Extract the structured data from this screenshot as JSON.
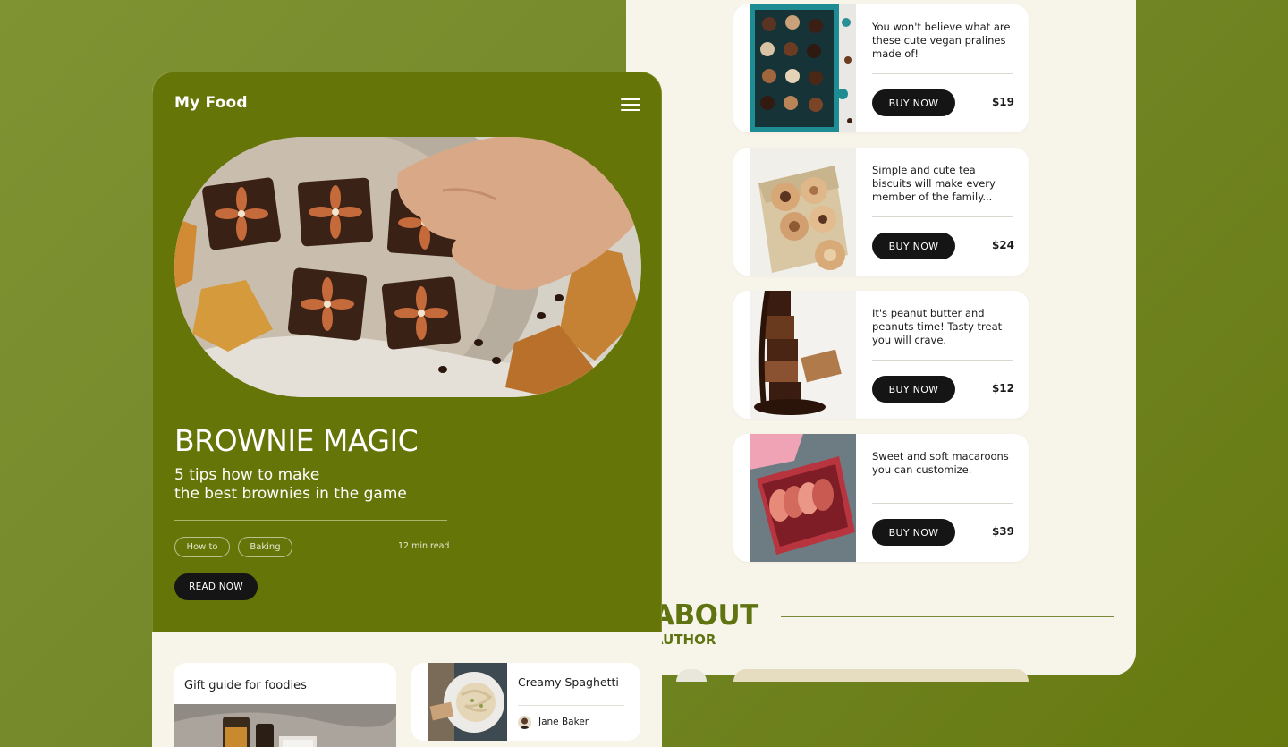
{
  "app": {
    "logo": "My Food"
  },
  "hero": {
    "title": "BROWNIE MAGIC",
    "subtitle_line1": "5 tips how to make",
    "subtitle_line2": "the best brownies in the game",
    "tags": [
      "How to",
      "Baking"
    ],
    "read_time": "12 min read",
    "read_button": "READ NOW"
  },
  "cards": {
    "gift": {
      "title": "Gift guide for foodies"
    },
    "pasta": {
      "title": "Creamy Spaghetti",
      "author": "Jane Baker"
    }
  },
  "products": [
    {
      "text": "You won't believe what are these cute vegan pralines made of!",
      "button": "BUY NOW",
      "price": "$19"
    },
    {
      "text": "Simple and cute tea biscuits will make every member of the family...",
      "button": "BUY NOW",
      "price": "$24"
    },
    {
      "text": "It's peanut butter and peanuts time! Tasty treat you will crave.",
      "button": "BUY NOW",
      "price": "$12"
    },
    {
      "text": "Sweet and soft macaroons you can customize.",
      "button": "BUY NOW",
      "price": "$39"
    }
  ],
  "about": {
    "title": "ABOUT",
    "subtitle": "AUTHOR"
  },
  "colors": {
    "brand_green": "#657507",
    "background_green": "#74882a",
    "cream": "#f7f4ea",
    "button_dark": "#151515"
  }
}
